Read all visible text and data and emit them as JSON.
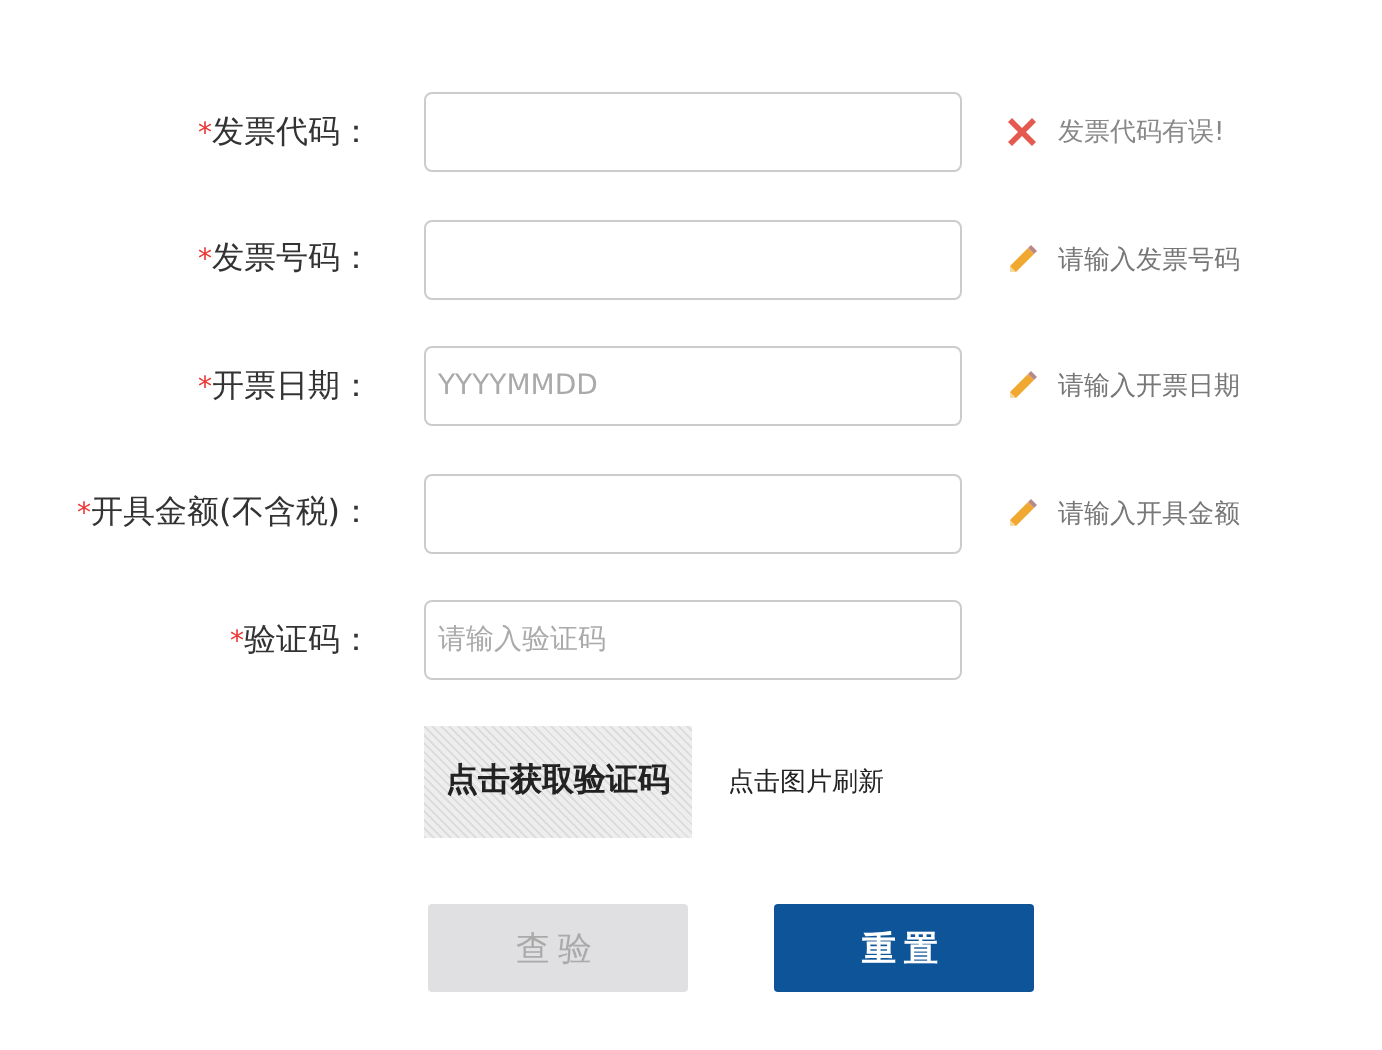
{
  "fields": [
    {
      "label": "发票代码：",
      "required_mark": "*",
      "hint": {
        "kind": "error",
        "text": "发票代码有误!"
      }
    },
    {
      "label": "发票号码：",
      "required_mark": "*",
      "hint": {
        "kind": "edit",
        "text": "请输入发票号码"
      }
    },
    {
      "label": "开票日期：",
      "required_mark": "*",
      "placeholder": "YYYYMMDD",
      "hint": {
        "kind": "edit",
        "text": "请输入开票日期"
      }
    },
    {
      "label": "开具金额(不含税)：",
      "required_mark": "*",
      "hint": {
        "kind": "edit",
        "text": "请输入开具金额"
      }
    },
    {
      "label": "验证码：",
      "required_mark": "*",
      "placeholder": "请输入验证码"
    }
  ],
  "captcha": {
    "image_text": "点击获取验证码",
    "refresh_text": "点击图片刷新"
  },
  "buttons": [
    {
      "label": "查验",
      "disabled": true
    },
    {
      "label": "重置",
      "disabled": false
    }
  ]
}
